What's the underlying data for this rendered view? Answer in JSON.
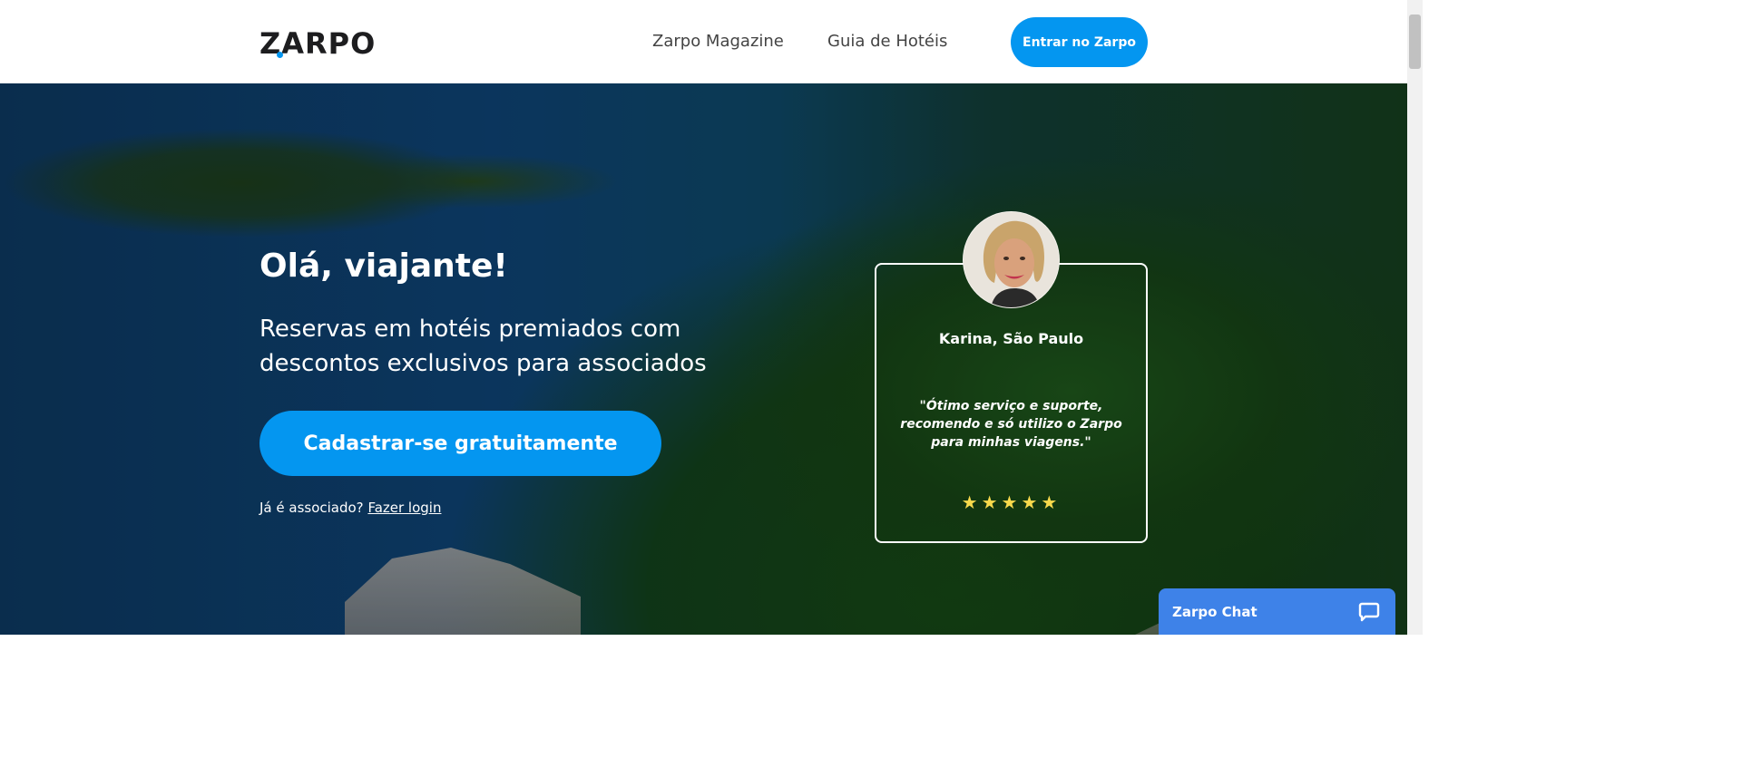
{
  "header": {
    "logo_text": "ZARPO",
    "nav": [
      {
        "label": "Zarpo Magazine"
      },
      {
        "label": "Guia de Hotéis"
      }
    ],
    "login_button": "Entrar no Zarpo"
  },
  "hero": {
    "title": "Olá, viajante!",
    "subtitle": "Reservas em hotéis premiados com descontos exclusivos para associados",
    "cta_button": "Cadastrar-se gratuitamente",
    "already_member": "Já é associado?",
    "login_link": "Fazer login"
  },
  "testimonial": {
    "name": "Karina, São Paulo",
    "quote": "\"Ótimo serviço e suporte, recomendo e só utilizo o Zarpo para minhas viagens.\"",
    "rating": 5,
    "stars": "★★★★★"
  },
  "chat": {
    "label": "Zarpo Chat",
    "icon": "chat-bubble-icon"
  },
  "colors": {
    "accent": "#0496f0",
    "chat": "#3e82e8",
    "stars": "#f7d94c"
  }
}
